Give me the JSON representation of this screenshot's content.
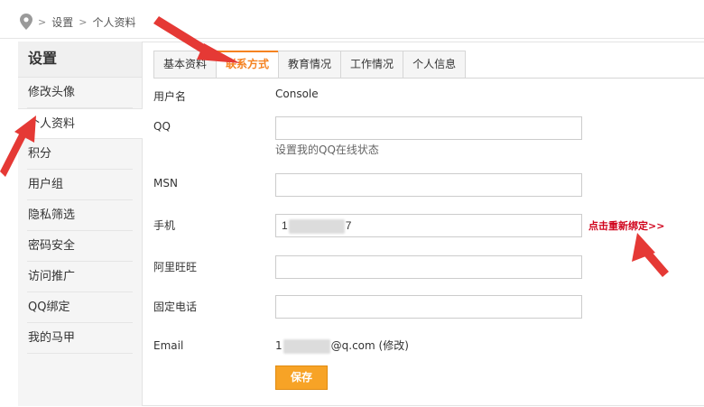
{
  "breadcrumb": {
    "sep": ">",
    "items": [
      "设置",
      "个人资料"
    ]
  },
  "sidebar": {
    "title": "设置",
    "items": [
      {
        "label": "修改头像"
      },
      {
        "label": "个人资料"
      },
      {
        "label": "积分"
      },
      {
        "label": "用户组"
      },
      {
        "label": "隐私筛选"
      },
      {
        "label": "密码安全"
      },
      {
        "label": "访问推广"
      },
      {
        "label": "QQ绑定"
      },
      {
        "label": "我的马甲"
      }
    ],
    "active_index": 1
  },
  "tabs": [
    {
      "label": "基本资料"
    },
    {
      "label": "联系方式"
    },
    {
      "label": "教育情况"
    },
    {
      "label": "工作情况"
    },
    {
      "label": "个人信息"
    }
  ],
  "active_tab": 1,
  "form": {
    "username_label": "用户名",
    "username_value": "Console",
    "qq_label": "QQ",
    "qq_value": "",
    "qq_hint": "设置我的QQ在线状态",
    "msn_label": "MSN",
    "msn_value": "",
    "phone_label": "手机",
    "phone_prefix": "1",
    "phone_suffix": "7",
    "rebind_link": "点击重新绑定>>",
    "aliwangwang_label": "阿里旺旺",
    "aliwangwang_value": "",
    "landline_label": "固定电话",
    "landline_value": "",
    "email_label": "Email",
    "email_prefix": "1",
    "email_suffix": "@q.com",
    "email_modify": "(修改)",
    "save_label": "保存"
  },
  "colors": {
    "accent": "#f58220",
    "save_bg": "#f7a326",
    "annotation": "#e53935",
    "rebind": "#d0021b"
  }
}
